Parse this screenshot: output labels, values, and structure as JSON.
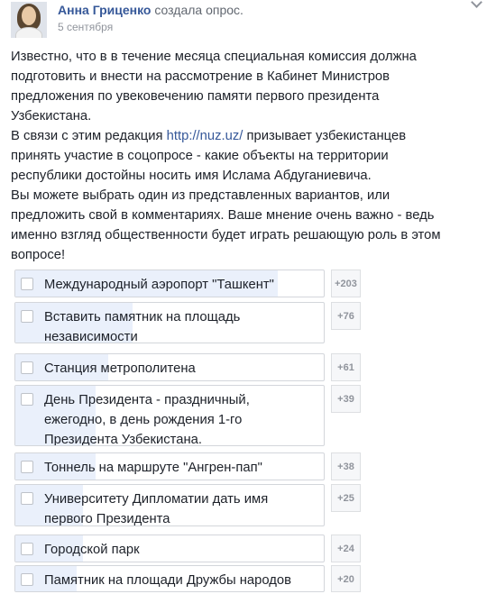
{
  "header": {
    "author": "Анна Гриценко",
    "action": "создала опрос.",
    "date": "5 сентября",
    "menu_icon": "chevron-down-icon"
  },
  "post": {
    "lines": [
      "Известно, что в в течение месяца специальная комиссия должна подготовить и внести на рассмотрение в Кабинет Министров предложения по увековечению памяти первого президента Узбекистана.",
      "В связи с этим редакция ",
      "http://nuz.uz/",
      " призывает узбекистанцев принять участие в соцопросе - какие объекты на территории республики достойны носить имя Ислама Абдуганиевича.",
      "Вы можете выбрать один из представленных вариантов, или предложить свой в комментариях. Ваше мнение очень важно - ведь именно взгляд общественности будет играть решающую роль в этом вопросе!"
    ]
  },
  "poll": {
    "options": [
      {
        "label": "Международный аэропорт \"Ташкент\"",
        "count": "+203",
        "share": 0.85
      },
      {
        "label": "Вставить памятник на площадь независимости",
        "count": "+76",
        "share": 0.38
      },
      {
        "label": "Станция метрополитена",
        "count": "+61",
        "share": 0.3
      },
      {
        "label": "День Президента - праздничный, ежегодно, в день рождения 1-го Президента Узбекистана.",
        "count": "+39",
        "share": 0.26
      },
      {
        "label": "Тоннель на маршруте \"Ангрен-пап\"",
        "count": "+38",
        "share": 0.26
      },
      {
        "label": "Университету Дипломатии дать имя первого Президента",
        "count": "+25",
        "share": 0.22
      },
      {
        "label": "Городской парк",
        "count": "+24",
        "share": 0.22
      },
      {
        "label": "Памятник на площади Дружбы народов",
        "count": "+20",
        "share": 0.2
      }
    ]
  }
}
